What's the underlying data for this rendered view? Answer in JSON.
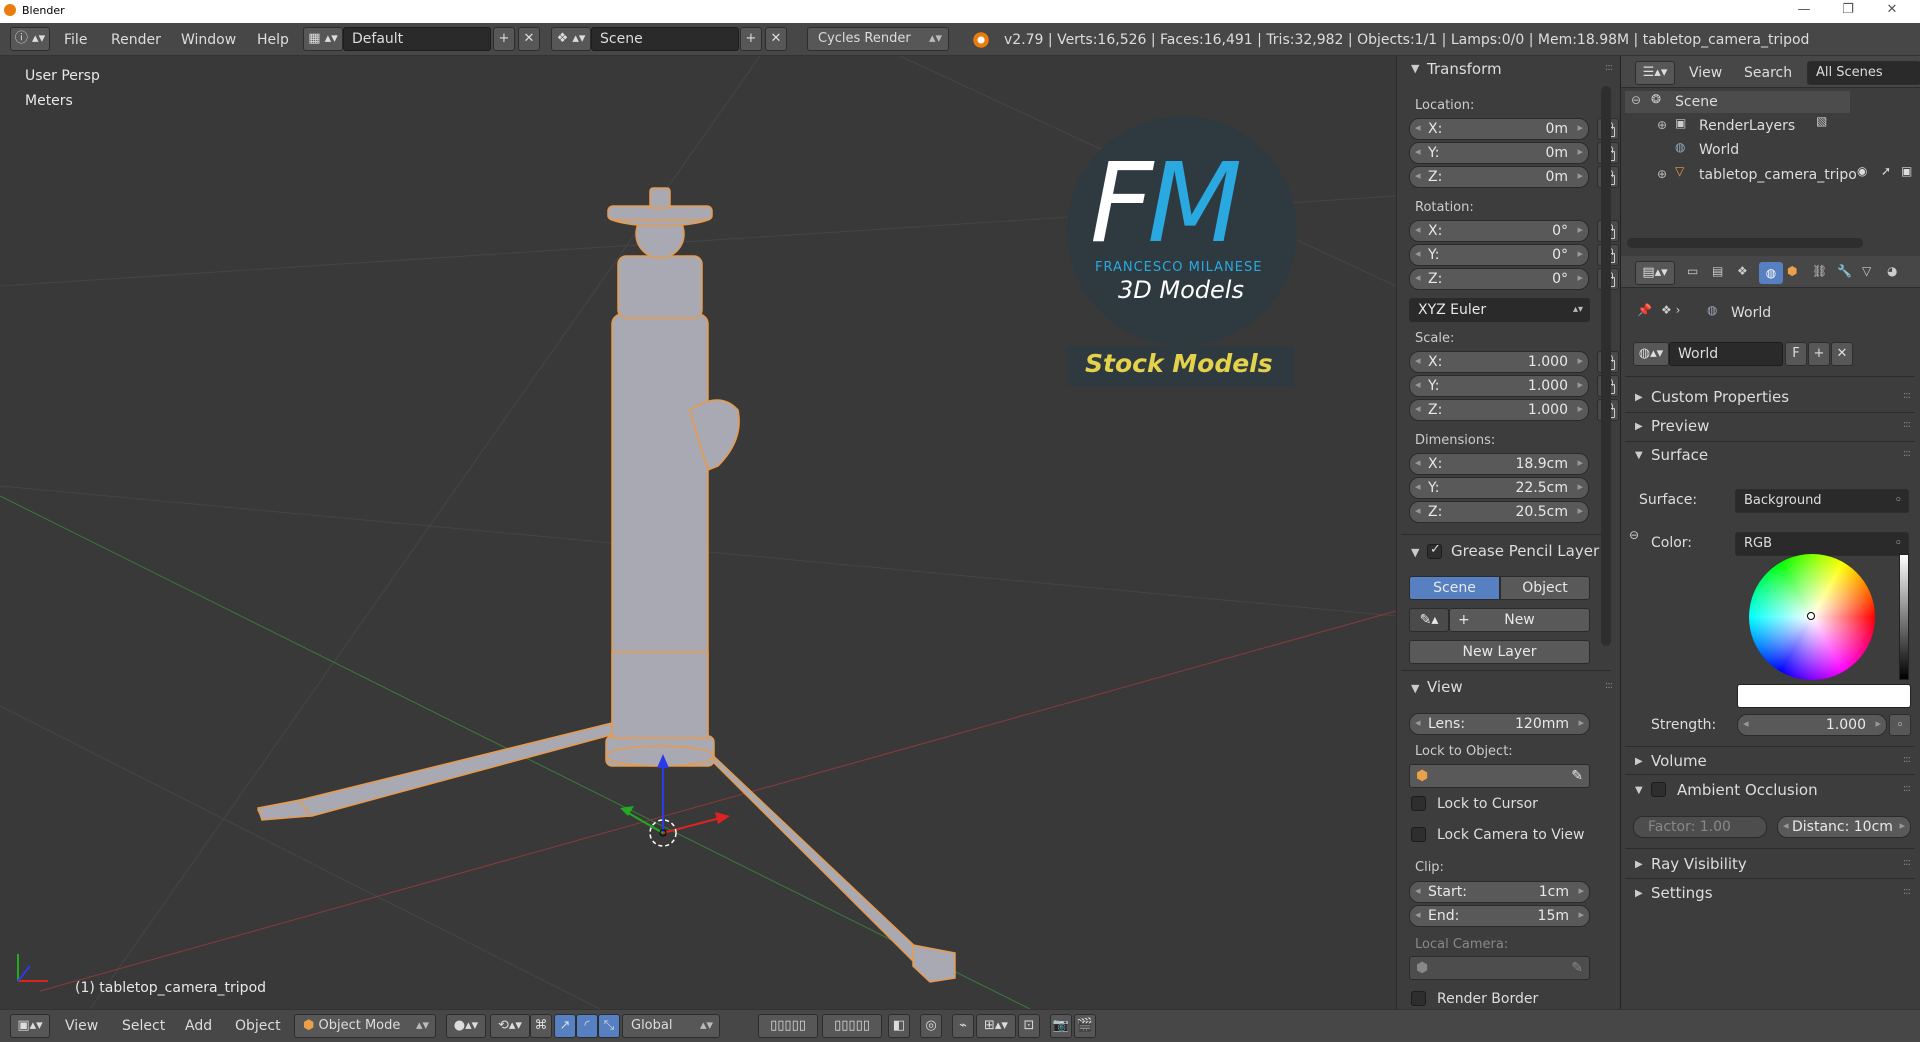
{
  "window": {
    "title": "Blender",
    "minimize": "—",
    "maximize": "❐",
    "close": "✕"
  },
  "topbar": {
    "menus": [
      "File",
      "Render",
      "Window",
      "Help"
    ],
    "layout": "Default",
    "scene": "Scene",
    "engine": "Cycles Render",
    "stats": "v2.79 | Verts:16,526 | Faces:16,491 | Tris:32,982 | Objects:1/1 | Lamps:0/0 | Mem:18.98M | tabletop_camera_tripod"
  },
  "viewport": {
    "view_name": "User Persp",
    "units": "Meters",
    "object_label": "(1) tabletop_camera_tripod",
    "logo": {
      "letters": "FM",
      "line1": "FRANCESCO MILANESE",
      "line2": "3D Models",
      "badge": "Stock Models"
    }
  },
  "transform": {
    "header": "Transform",
    "location_label": "Location:",
    "location": [
      {
        "k": "X:",
        "v": "0m"
      },
      {
        "k": "Y:",
        "v": "0m"
      },
      {
        "k": "Z:",
        "v": "0m"
      }
    ],
    "rotation_label": "Rotation:",
    "rotation": [
      {
        "k": "X:",
        "v": "0°"
      },
      {
        "k": "Y:",
        "v": "0°"
      },
      {
        "k": "Z:",
        "v": "0°"
      }
    ],
    "rotation_mode": "XYZ Euler",
    "scale_label": "Scale:",
    "scale": [
      {
        "k": "X:",
        "v": "1.000"
      },
      {
        "k": "Y:",
        "v": "1.000"
      },
      {
        "k": "Z:",
        "v": "1.000"
      }
    ],
    "dimensions_label": "Dimensions:",
    "dimensions": [
      {
        "k": "X:",
        "v": "18.9cm"
      },
      {
        "k": "Y:",
        "v": "22.5cm"
      },
      {
        "k": "Z:",
        "v": "20.5cm"
      }
    ]
  },
  "grease": {
    "header": "Grease Pencil Layer",
    "scene": "Scene",
    "object": "Object",
    "new": "New",
    "new_layer": "New Layer"
  },
  "viewpanel": {
    "header": "View",
    "lens_k": "Lens:",
    "lens_v": "120mm",
    "lock_to_object": "Lock to Object:",
    "lock_to_cursor": "Lock to Cursor",
    "lock_camera": "Lock Camera to View",
    "clip": "Clip:",
    "start_k": "Start:",
    "start_v": "1cm",
    "end_k": "End:",
    "end_v": "15m",
    "local_camera": "Local Camera:",
    "render_border": "Render Border"
  },
  "outliner": {
    "menus": [
      "View",
      "Search"
    ],
    "filter": "All Scenes",
    "items": [
      "Scene",
      "RenderLayers",
      "World",
      "tabletop_camera_tripo"
    ]
  },
  "props": {
    "breadcrumb": "World",
    "world_name": "World",
    "fake_user": "F",
    "sections": {
      "custom": "Custom Properties",
      "preview": "Preview",
      "surface": "Surface",
      "volume": "Volume",
      "ao": "Ambient Occlusion",
      "ray": "Ray Visibility",
      "settings": "Settings"
    },
    "surface_label": "Surface:",
    "surface_value": "Background",
    "color_label": "Color:",
    "color_value": "RGB",
    "strength_label": "Strength:",
    "strength_value": "1.000",
    "factor": "Factor:      1.00",
    "distance": "Distanc: 10cm"
  },
  "bottombar": {
    "menus": [
      "View",
      "Select",
      "Add",
      "Object"
    ],
    "mode": "Object Mode",
    "orientation": "Global"
  },
  "colors": {
    "accent": "#5680c2",
    "selected": "#e8a04a",
    "background": "#393939"
  }
}
